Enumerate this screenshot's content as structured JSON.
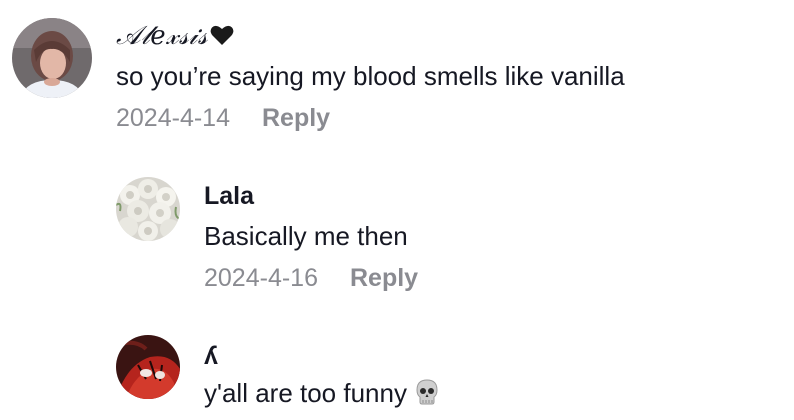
{
  "comments": [
    {
      "username": "𝒜𝓁𝑒𝓍𝓈𝒾𝓈",
      "username_icon": "black-heart-icon",
      "text": "so you’re saying my blood smells like vanilla",
      "date": "2024-4-14",
      "reply_label": "Reply"
    },
    {
      "username": "Lala",
      "text": "Basically me then",
      "date": "2024-4-16",
      "reply_label": "Reply"
    },
    {
      "username": "ʎ",
      "text": "y'all are too funny",
      "text_icon": "skull-icon"
    }
  ]
}
